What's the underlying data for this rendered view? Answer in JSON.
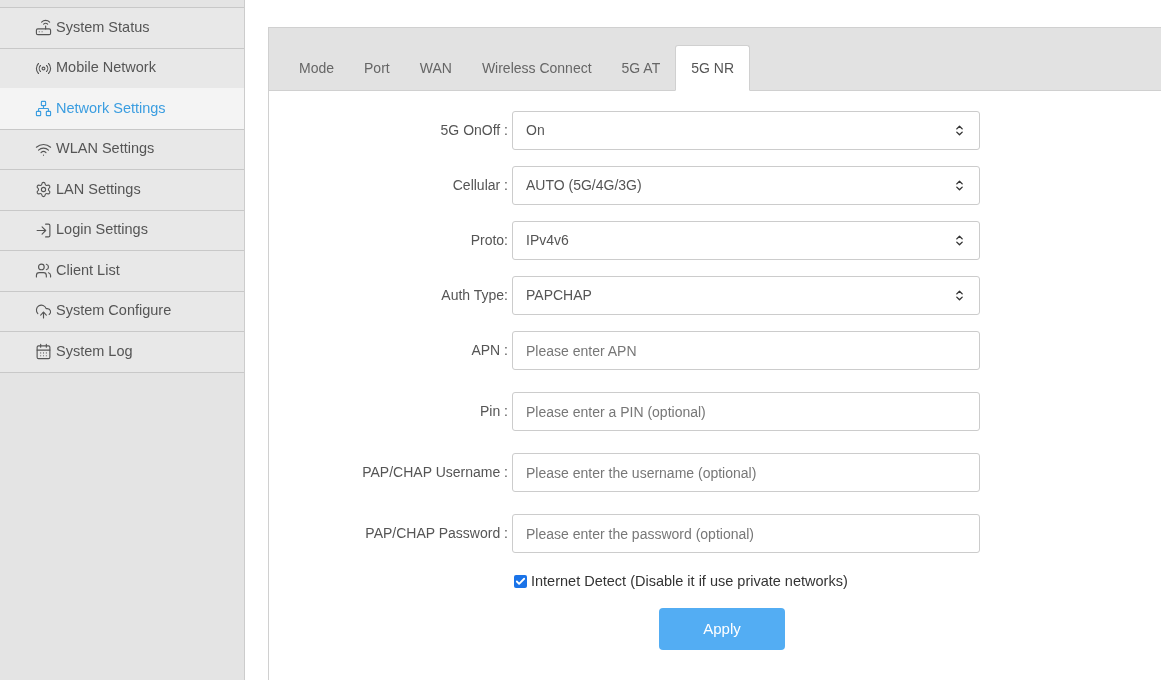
{
  "sidebar": {
    "items": [
      {
        "label": "System Status",
        "selected": false
      },
      {
        "label": "Mobile Network",
        "selected": false
      },
      {
        "label": "Network Settings",
        "selected": true
      },
      {
        "label": "WLAN Settings",
        "selected": false
      },
      {
        "label": "LAN Settings",
        "selected": false
      },
      {
        "label": "Login Settings",
        "selected": false
      },
      {
        "label": "Client List",
        "selected": false
      },
      {
        "label": "System Configure",
        "selected": false
      },
      {
        "label": "System Log",
        "selected": false
      }
    ]
  },
  "tabs": [
    {
      "label": "Mode",
      "selected": false
    },
    {
      "label": "Port",
      "selected": false
    },
    {
      "label": "WAN",
      "selected": false
    },
    {
      "label": "Wireless Connect",
      "selected": false
    },
    {
      "label": "5G AT",
      "selected": false
    },
    {
      "label": "5G NR",
      "selected": true
    }
  ],
  "form": {
    "fields": [
      {
        "kind": "select",
        "label": "5G OnOff :",
        "value": "On"
      },
      {
        "kind": "select",
        "label": "Cellular :",
        "value": "AUTO (5G/4G/3G)"
      },
      {
        "kind": "select",
        "label": "Proto:",
        "value": "IPv4v6"
      },
      {
        "kind": "select",
        "label": "Auth Type:",
        "value": "PAPCHAP"
      },
      {
        "kind": "input",
        "label": "APN :",
        "placeholder": "Please enter APN"
      },
      {
        "kind": "input",
        "label": "Pin :",
        "placeholder": "Please enter a PIN (optional)"
      },
      {
        "kind": "input",
        "label": "PAP/CHAP Username :",
        "placeholder": "Please enter the username (optional)"
      },
      {
        "kind": "input",
        "label": "PAP/CHAP Password :",
        "placeholder": "Please enter the password (optional)"
      }
    ],
    "internet_detect": {
      "label": "Internet Detect (Disable it if use private networks)",
      "checked": true
    },
    "apply_button": "Apply"
  }
}
